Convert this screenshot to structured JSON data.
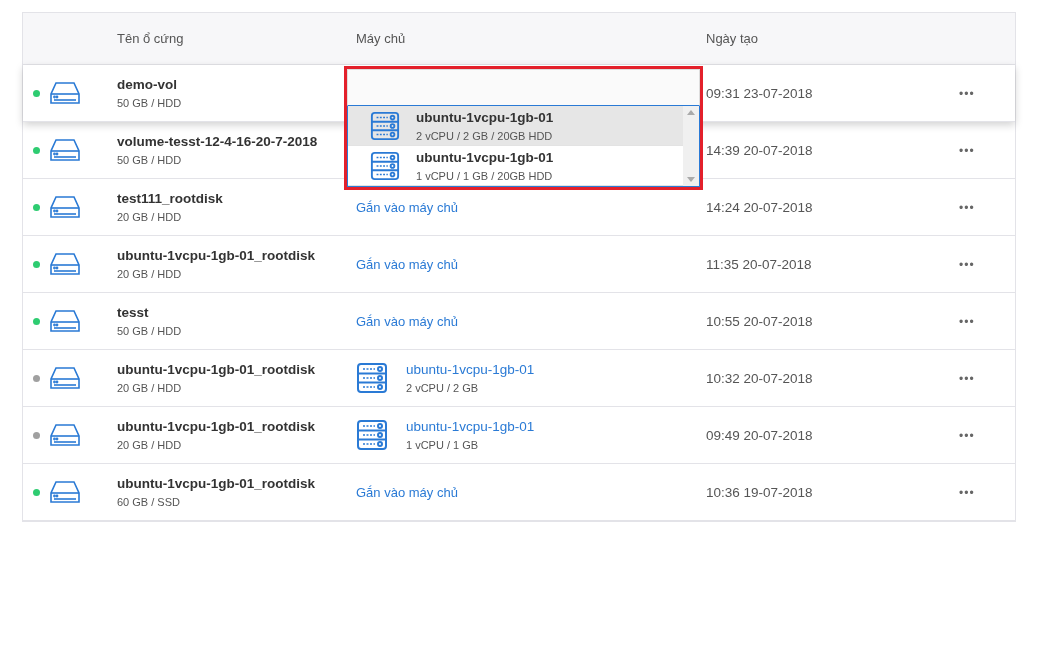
{
  "table": {
    "columns": [
      "Tên ổ cứng",
      "Máy chủ",
      "Ngày tạo"
    ],
    "rows": [
      {
        "name": "demo-vol",
        "size": "50 GB / HDD",
        "color": "#2ecc71",
        "hovered": true,
        "created": "09:31 23-07-2018",
        "actions": "•••"
      },
      {
        "name": "volume-tesst-12-4-16-20-7-2018",
        "size": "50 GB / HDD",
        "color": "#2ecc71",
        "hovered": false,
        "created": "14:39 20-07-2018",
        "actions": "•••"
      },
      {
        "name": "test111_rootdisk",
        "size": "20 GB / HDD",
        "color": "#2ecc71",
        "hovered": false,
        "server": {
          "kind": "attach",
          "label": "Gắn vào máy chủ"
        },
        "created": "14:24 20-07-2018",
        "actions": "•••"
      },
      {
        "name": "ubuntu-1vcpu-1gb-01_rootdisk",
        "size": "20 GB / HDD",
        "color": "#2ecc71",
        "hovered": false,
        "server": {
          "kind": "attach",
          "label": "Gắn vào máy chủ"
        },
        "created": "11:35 20-07-2018",
        "actions": "•••"
      },
      {
        "name": "tesst",
        "size": "50 GB / HDD",
        "color": "#2ecc71",
        "hovered": false,
        "server": {
          "kind": "attach",
          "label": "Gắn vào máy chủ"
        },
        "created": "10:55 20-07-2018",
        "actions": "•••"
      },
      {
        "name": "ubuntu-1vcpu-1gb-01_rootdisk",
        "size": "20 GB / HDD",
        "color": "#a0a0a0",
        "hovered": false,
        "server": {
          "kind": "server",
          "label": "ubuntu-1vcpu-1gb-01",
          "spec": "2 vCPU / 2 GB"
        },
        "created": "10:32 20-07-2018",
        "actions": "•••"
      },
      {
        "name": "ubuntu-1vcpu-1gb-01_rootdisk",
        "size": "20 GB / HDD",
        "color": "#a0a0a0",
        "hovered": false,
        "server": {
          "kind": "server",
          "label": "ubuntu-1vcpu-1gb-01",
          "spec": "1 vCPU / 1 GB"
        },
        "created": "09:49 20-07-2018",
        "actions": "•••"
      },
      {
        "name": "ubuntu-1vcpu-1gb-01_rootdisk",
        "size": "60 GB / SSD",
        "color": "#2ecc71",
        "hovered": false,
        "server": {
          "kind": "attach",
          "label": "Gắn vào máy chủ"
        },
        "created": "10:36 19-07-2018",
        "actions": "•••"
      }
    ]
  },
  "server_dropdown": {
    "options": [
      {
        "name": "ubuntu-1vcpu-1gb-01",
        "spec": "2 vCPU / 2 GB / 20GB HDD",
        "highlighted": true
      },
      {
        "name": "ubuntu-1vcpu-1gb-01",
        "spec": "1 vCPU / 1 GB / 20GB HDD",
        "highlighted": false
      }
    ]
  }
}
